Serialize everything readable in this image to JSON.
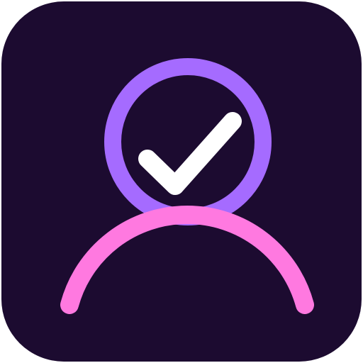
{
  "icon": {
    "name": "verified-user-icon",
    "colors": {
      "background": "#1c0b30",
      "head_ring": "#a56bff",
      "body_arc": "#ff79e0",
      "check": "#ffffff"
    }
  }
}
